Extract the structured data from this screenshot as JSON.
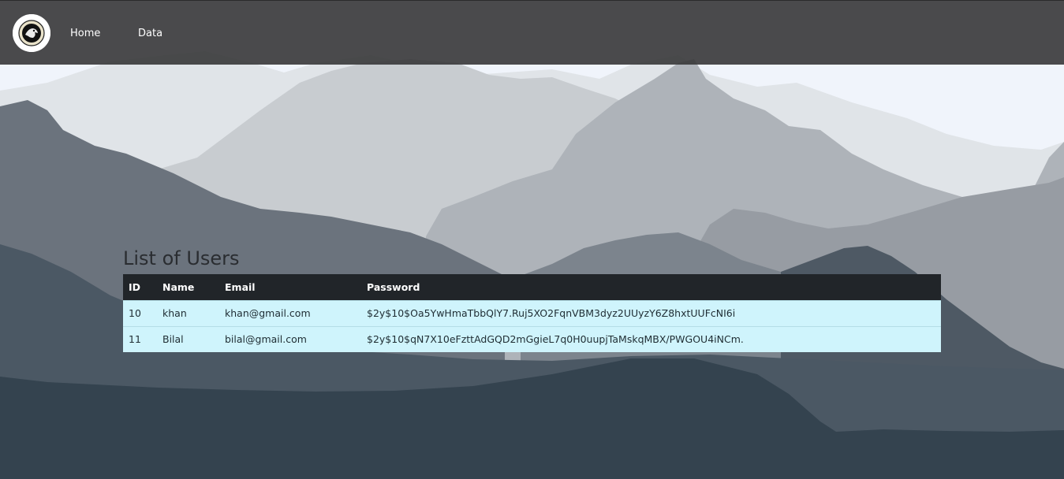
{
  "navbar": {
    "logo_icon": "circular-badge-logo",
    "links": [
      {
        "label": "Home"
      },
      {
        "label": "Data"
      }
    ]
  },
  "page": {
    "title": "List of Users"
  },
  "table": {
    "headers": [
      "ID",
      "Name",
      "Email",
      "Password"
    ],
    "rows": [
      [
        "10",
        "khan",
        "khan@gmail.com",
        "$2y$10$Oa5YwHmaTbbQlY7.Ruj5XO2FqnVBM3dyz2UUyzY6Z8hxtUUFcNI6i"
      ],
      [
        "11",
        "Bilal",
        "bilal@gmail.com",
        "$2y$10$qN7X10eFzttAdGQD2mGgieL7q0H0uupjTaMskqMBX/PWGOU4iNCm."
      ]
    ]
  },
  "colors": {
    "navbar_bg": "#373739",
    "table_header_bg": "#212529",
    "table_row_bg": "#cff4fc",
    "sky": "#f0f4fb",
    "mountain_front": "#34434f"
  }
}
